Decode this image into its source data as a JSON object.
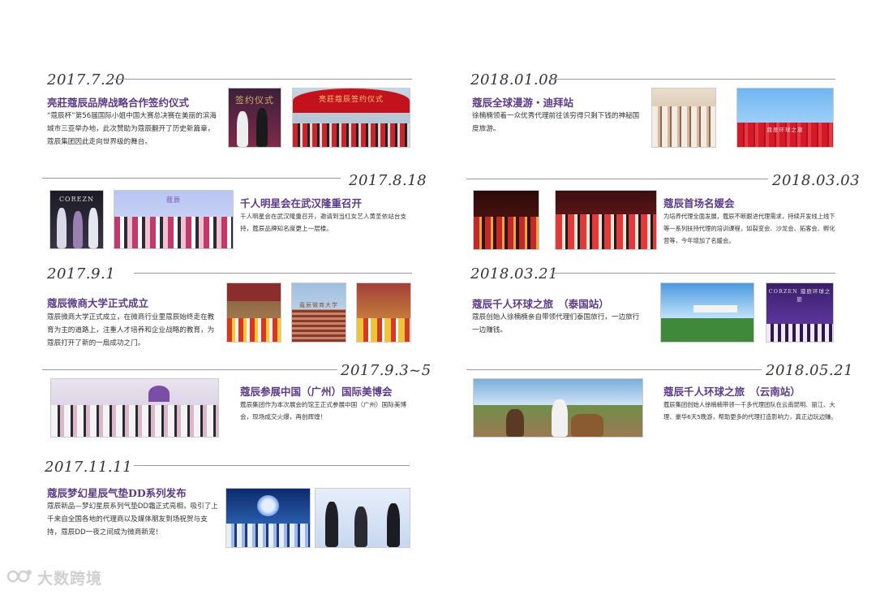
{
  "entries": [
    {
      "date": "2017.7.20",
      "title": "亮莊蔻辰品牌战略合作签约仪式",
      "desc": "“蔻辰杯”第56届国际小姐中国大赛总决赛在美丽的滨海城市三亚举办地，此次赞助为蔻辰翻开了历史新篇章，蔻辰集团因此走向世界级的舞台。",
      "photos": [
        {
          "label": "签约仪式"
        },
        {
          "label": "亮莊蔻辰签约仪式"
        }
      ]
    },
    {
      "date": "2017.8.18",
      "title": "千人明星会在武汉隆重召开",
      "desc": "千人明星会在武汉隆重召开，邀请到当红女艺人黄圣依站台支持，蔻辰品牌知名度更上一层楼。",
      "photos": [
        {
          "label": "COREZN"
        },
        {
          "label": "蔻辰"
        }
      ]
    },
    {
      "date": "2017.9.1",
      "title": "蔻辰微商大学正式成立",
      "desc": "蔻辰微商大学正式成立，在微商行业里蔻辰始终走在教育为主的道路上，注重人才培养和企业战略的教育，为蔻辰打开了新的一扇成功之门。",
      "photos": [
        {
          "label": ""
        },
        {
          "label": "蔻辰微商大学"
        },
        {
          "label": ""
        }
      ]
    },
    {
      "date": "2017.9.3~5",
      "title": "蔻辰参展中国（广州）国际美博会",
      "desc": "蔻辰集团作为本次展会的馆王正式参展中国（广州）国际美博会，现场成交火爆，再创辉煌！",
      "photos": [
        {
          "label": ""
        }
      ]
    },
    {
      "date": "2017.11.11",
      "title": "蔻辰梦幻星辰气垫DD系列发布",
      "desc": "蔻辰新品—梦幻星辰系列气垫DD霜正式亮相，吸引了上千来自全国各地的代理商以及媒体朋友到场祝贺与支持，蔻辰DD一夜之间成为微商新宠！",
      "photos": [
        {
          "label": ""
        },
        {
          "label": ""
        }
      ]
    },
    {
      "date": "2018.01.08",
      "title": "蔻辰全球漫游・迪拜站",
      "desc": "徐楠楠领着一众优秀代理前往该穷得只剩下钱的神秘国度旅游。",
      "photos": [
        {
          "label": ""
        },
        {
          "label": "蔻辰环球之旅"
        }
      ]
    },
    {
      "date": "2018.03.03",
      "title": "蔻辰首场名媛会",
      "desc": "为培养代理全面发展，蔻辰不断跟进代理需求，持续开发线上线下等一系列扶持代理的培训课程，如裂变会、沙龙会、拓客会、孵化营等，今年增加了名媛会。",
      "photos": [
        {
          "label": ""
        },
        {
          "label": ""
        }
      ]
    },
    {
      "date": "2018.03.21",
      "title": "蔻辰千人环球之旅　（泰国站）",
      "desc": "蔻辰创始人徐楠楠亲自带领代理们泰国旅行，一边旅行一边赚钱。",
      "photos": [
        {
          "label": ""
        },
        {
          "label": "CORZEN 蔻辰环球之旅"
        }
      ]
    },
    {
      "date": "2018.05.21",
      "title": "蔻辰千人环球之旅　（云南站）",
      "desc": "蔻辰集团创始人徐楠楠带领一千多代理团队在云南昆明、丽江、大理、豪华6天5晚游，帮助更多的代理打造影响力，真正边玩边赚。",
      "photos": [
        {
          "label": ""
        }
      ]
    }
  ],
  "watermark": "大数跨境",
  "colors": {
    "title": "#5b3a88",
    "rule": "#9a9a9a"
  }
}
